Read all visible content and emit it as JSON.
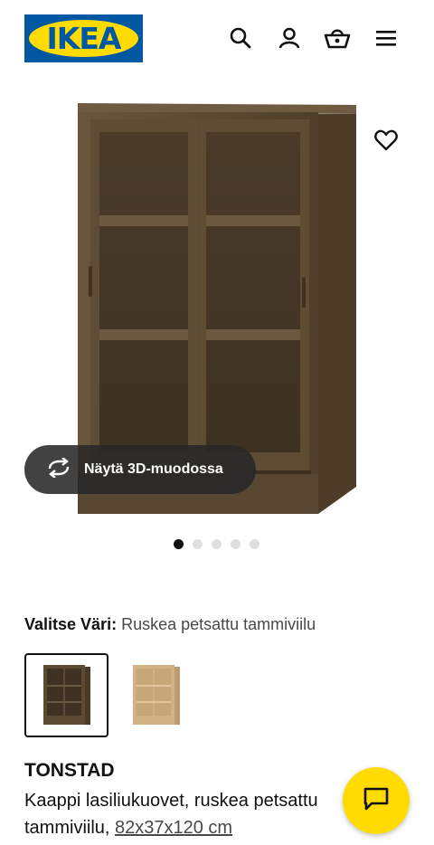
{
  "header": {
    "logo_text": "IKEA",
    "icons": [
      "search-icon",
      "user-icon",
      "cart-icon",
      "menu-icon"
    ]
  },
  "product_view": {
    "view3d_label": "Näytä 3D-muodossa",
    "carousel": {
      "count": 5,
      "active": 1
    }
  },
  "color": {
    "label": "Valitse Väri:",
    "value": "Ruskea petsattu tammiviilu",
    "options": [
      "brown-stained-oak",
      "white-stained-oak"
    ]
  },
  "product": {
    "name": "TONSTAD",
    "description": "Kaappi lasiliukuovet, ruskea petsattu tammiviilu,",
    "dimensions": "82x37x120 cm"
  },
  "colors": {
    "ikea_blue": "#0058a3",
    "ikea_yellow": "#ffdb00",
    "wood_dark": "#5c4a33",
    "wood_light": "#c9a679"
  }
}
